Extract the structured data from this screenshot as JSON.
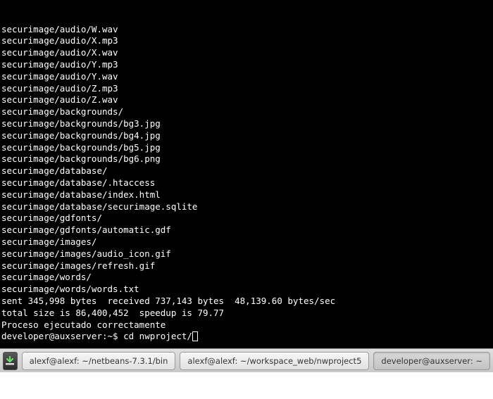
{
  "terminal": {
    "lines": [
      "securimage/audio/W.wav",
      "securimage/audio/X.mp3",
      "securimage/audio/X.wav",
      "securimage/audio/Y.mp3",
      "securimage/audio/Y.wav",
      "securimage/audio/Z.mp3",
      "securimage/audio/Z.wav",
      "securimage/backgrounds/",
      "securimage/backgrounds/bg3.jpg",
      "securimage/backgrounds/bg4.jpg",
      "securimage/backgrounds/bg5.jpg",
      "securimage/backgrounds/bg6.png",
      "securimage/database/",
      "securimage/database/.htaccess",
      "securimage/database/index.html",
      "securimage/database/securimage.sqlite",
      "securimage/gdfonts/",
      "securimage/gdfonts/automatic.gdf",
      "securimage/images/",
      "securimage/images/audio_icon.gif",
      "securimage/images/refresh.gif",
      "securimage/words/",
      "securimage/words/words.txt",
      "",
      "sent 345,998 bytes  received 737,143 bytes  48,139.60 bytes/sec",
      "total size is 86,400,452  speedup is 79.77",
      "Proceso ejecutado correctamente"
    ],
    "prompt": "developer@auxserver:~$",
    "command": "cd nwproject/"
  },
  "taskbar": {
    "tabs": [
      {
        "label": "alexf@alexf: ~/netbeans-7.3.1/bin",
        "active": false
      },
      {
        "label": "alexf@alexf: ~/workspace_web/nwproject5",
        "active": false
      },
      {
        "label": "developer@auxserver: ~",
        "active": true
      }
    ]
  }
}
